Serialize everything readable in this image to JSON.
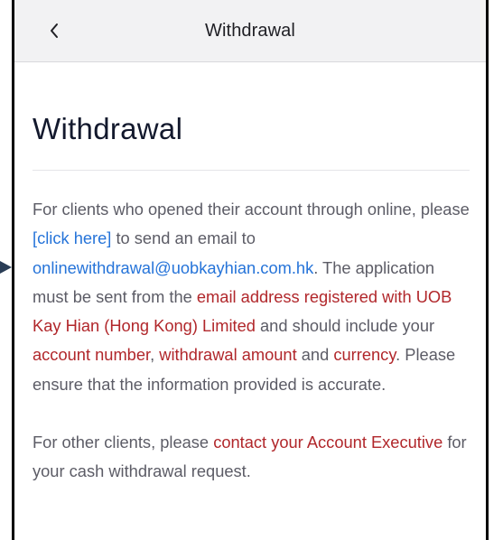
{
  "header": {
    "back_icon": "chevron-left-icon",
    "title": "Withdrawal"
  },
  "page": {
    "heading": "Withdrawal"
  },
  "paragraph1": {
    "t1": "For clients who opened their account through online, please ",
    "click_here": "[click here]",
    "t2": " to send an email to ",
    "email": "onlinewithdrawal@uobkayhian.com.hk",
    "t3": ". The application must be sent from the ",
    "h1": "email address registered with UOB Kay Hian (Hong Kong) Limited",
    "t4": " and should include your ",
    "h2": "account number",
    "t5": ", ",
    "h3": "withdrawal amount",
    "t6": " and ",
    "h4": "currency",
    "t7": ". Please ensure that the information provided is accurate."
  },
  "paragraph2": {
    "t1": "For other clients, please ",
    "h1": "contact your Account Executive",
    "t2": " for your cash withdrawal request."
  },
  "colors": {
    "highlight": "#b1272b",
    "link": "#2674d9",
    "body_text": "#5c5c66",
    "heading": "#13192d",
    "topbar": "#f2f2f3",
    "arrow": "#2a3d56"
  }
}
